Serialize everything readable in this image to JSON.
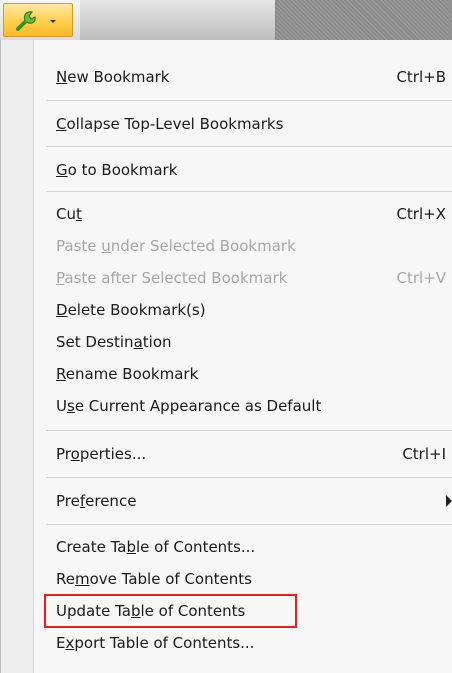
{
  "toolbar": {
    "options_button_icon": "wrench-icon",
    "dropdown_icon": "chevron-down-icon"
  },
  "menu": {
    "items": [
      {
        "pre": "",
        "u": "N",
        "post": "ew Bookmark",
        "shortcut": "Ctrl+B",
        "disabled": false
      },
      {
        "pre": "",
        "u": "C",
        "post": "ollapse Top-Level Bookmarks",
        "shortcut": "",
        "disabled": false
      },
      {
        "pre": "",
        "u": "G",
        "post": "o to Bookmark",
        "shortcut": "",
        "disabled": false
      },
      {
        "pre": "Cu",
        "u": "t",
        "post": "",
        "shortcut": "Ctrl+X",
        "disabled": false
      },
      {
        "pre": "Paste ",
        "u": "u",
        "post": "nder Selected Bookmark",
        "shortcut": "",
        "disabled": true
      },
      {
        "pre": "",
        "u": "P",
        "post": "aste after Selected Bookmark",
        "shortcut": "Ctrl+V",
        "disabled": true
      },
      {
        "pre": "",
        "u": "D",
        "post": "elete Bookmark(s)",
        "shortcut": "",
        "disabled": false
      },
      {
        "pre": "Set Destin",
        "u": "a",
        "post": "tion",
        "shortcut": "",
        "disabled": false
      },
      {
        "pre": "",
        "u": "R",
        "post": "ename Bookmark",
        "shortcut": "",
        "disabled": false
      },
      {
        "pre": "U",
        "u": "s",
        "post": "e Current Appearance as Default",
        "shortcut": "",
        "disabled": false
      },
      {
        "pre": "Pr",
        "u": "o",
        "post": "perties...",
        "shortcut": "Ctrl+I",
        "disabled": false
      },
      {
        "pre": "Pre",
        "u": "f",
        "post": "erence",
        "shortcut": "",
        "disabled": false
      },
      {
        "pre": "Create Ta",
        "u": "b",
        "post": "le of Contents...",
        "shortcut": "",
        "disabled": false
      },
      {
        "pre": "Re",
        "u": "m",
        "post": "ove Table of Contents",
        "shortcut": "",
        "disabled": false
      },
      {
        "pre": "Update Ta",
        "u": "b",
        "post": "le of Contents",
        "shortcut": "",
        "disabled": false
      },
      {
        "pre": "E",
        "u": "x",
        "post": "port Table of Contents...",
        "shortcut": "",
        "disabled": false
      }
    ],
    "highlighted_item": "Update Table of Contents",
    "highlight_color": "#e41f1f"
  }
}
